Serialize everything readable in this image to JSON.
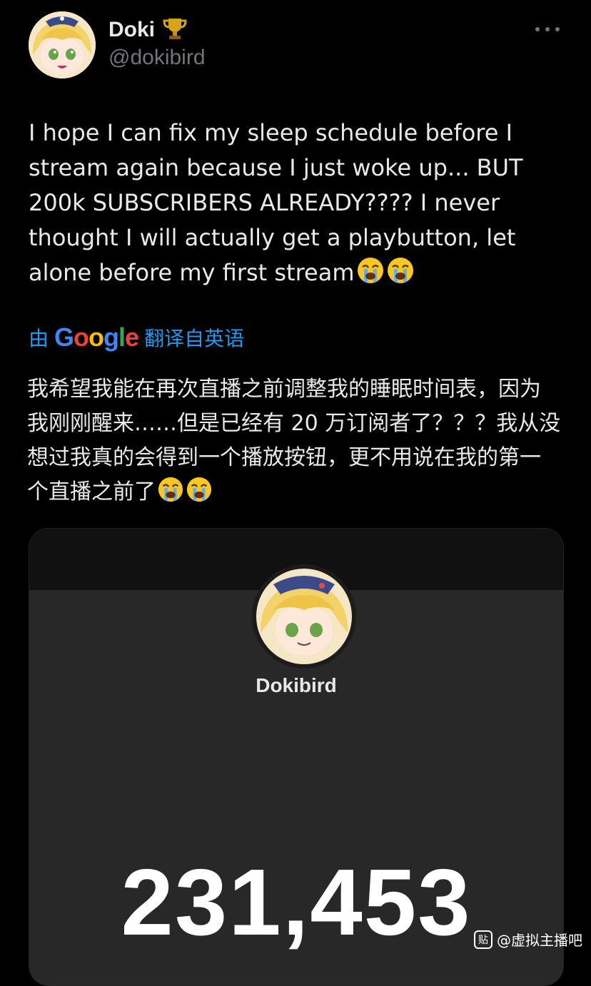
{
  "author": {
    "display_name": "Doki",
    "badge_icon": "trophy-icon",
    "handle": "@dokibird"
  },
  "tweet": {
    "text": "I hope I can fix my sleep schedule before I stream again because I just woke up... BUT 200k SUBSCRIBERS ALREADY???? I never thought I will actually get a playbutton, let alone before my first stream",
    "emojis": [
      "loudly-crying-face-icon",
      "loudly-crying-face-icon"
    ]
  },
  "translation": {
    "prefix": "由",
    "provider": "Google",
    "suffix": "翻译自英语",
    "text": "我希望我能在再次直播之前调整我的睡眠时间表，因为我刚刚醒来……但是已经有 20 万订阅者了？？？我从没想过我真的会得到一个播放按钮，更不用说在我的第一个直播之前了"
  },
  "media": {
    "channel_name": "Dokibird",
    "subscriber_count": "231,453"
  },
  "watermark": {
    "icon_text": "贴",
    "text": "@虚拟主播吧"
  },
  "colors": {
    "background": "#000000",
    "text": "#e7e9ea",
    "muted": "#71767b",
    "link": "#1d9bf0"
  }
}
